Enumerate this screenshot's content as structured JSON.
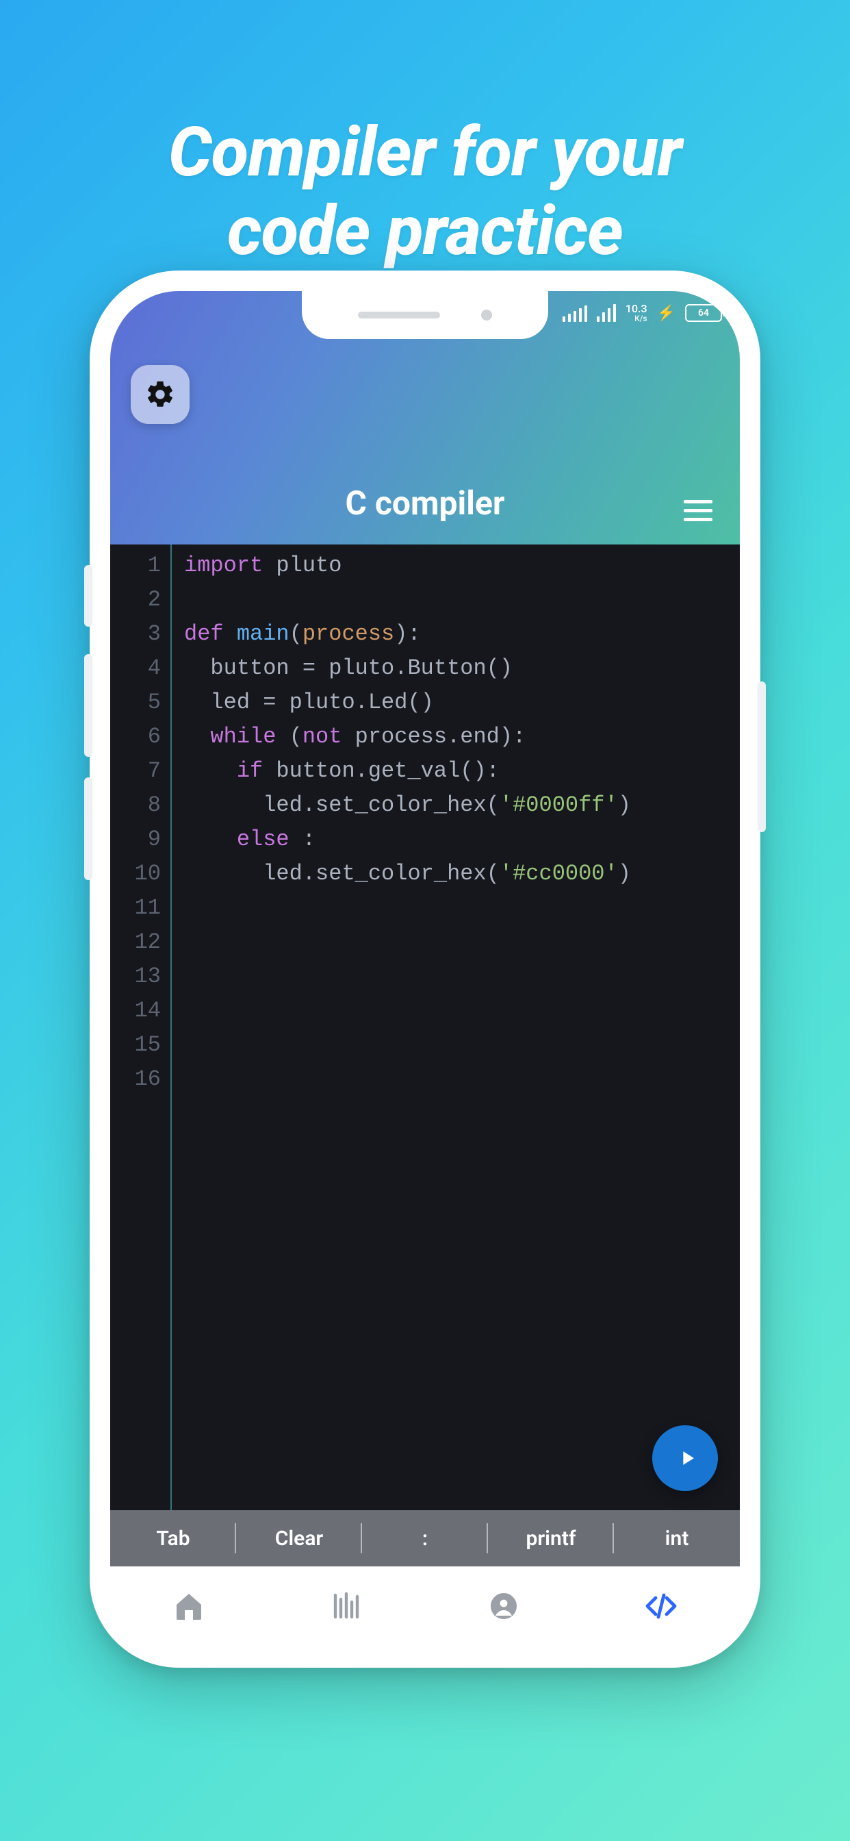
{
  "headline": {
    "line1": "Compiler for your",
    "line2": "code practice"
  },
  "status": {
    "data_rate": "10.3",
    "data_unit": "K/s",
    "battery_pct": "64"
  },
  "header": {
    "title": "C compiler"
  },
  "editor": {
    "total_lines": 16,
    "lines": [
      {
        "n": 1,
        "tokens": [
          [
            "kw-import",
            "import"
          ],
          [
            "ident",
            " pluto"
          ]
        ]
      },
      {
        "n": 2,
        "tokens": []
      },
      {
        "n": 3,
        "tokens": [
          [
            "kw-def",
            "def "
          ],
          [
            "fn-name",
            "main"
          ],
          [
            "punct",
            "("
          ],
          [
            "param",
            "process"
          ],
          [
            "punct",
            "):"
          ]
        ]
      },
      {
        "n": 4,
        "tokens": [
          [
            "ident",
            "  button "
          ],
          [
            "punct",
            "= "
          ],
          [
            "call",
            "pluto.Button()"
          ]
        ]
      },
      {
        "n": 5,
        "tokens": [
          [
            "ident",
            "  led "
          ],
          [
            "punct",
            "= "
          ],
          [
            "call",
            "pluto.Led()"
          ]
        ]
      },
      {
        "n": 6,
        "tokens": [
          [
            "kw-while",
            "  while "
          ],
          [
            "punct",
            "("
          ],
          [
            "kw-not",
            "not "
          ],
          [
            "ident",
            "process.end"
          ],
          [
            "punct",
            "):"
          ]
        ]
      },
      {
        "n": 7,
        "tokens": [
          [
            "kw-if",
            "    if "
          ],
          [
            "call",
            "button.get_val():"
          ]
        ]
      },
      {
        "n": 8,
        "tokens": [
          [
            "ident",
            "      "
          ],
          [
            "call",
            "led.set_color_hex("
          ],
          [
            "str",
            "'#0000ff'"
          ],
          [
            "punct",
            ")"
          ]
        ]
      },
      {
        "n": 9,
        "tokens": [
          [
            "kw-else",
            "    else "
          ],
          [
            "punct",
            ":"
          ]
        ]
      },
      {
        "n": 10,
        "tokens": [
          [
            "ident",
            "      "
          ],
          [
            "call",
            "led.set_color_hex("
          ],
          [
            "str",
            "'#cc0000'"
          ],
          [
            "punct",
            ")"
          ]
        ]
      }
    ]
  },
  "snippets": [
    "Tab",
    "Clear",
    ":",
    "printf",
    "int"
  ],
  "nav": {
    "items": [
      "home",
      "library",
      "profile",
      "code"
    ],
    "active_index": 3
  }
}
